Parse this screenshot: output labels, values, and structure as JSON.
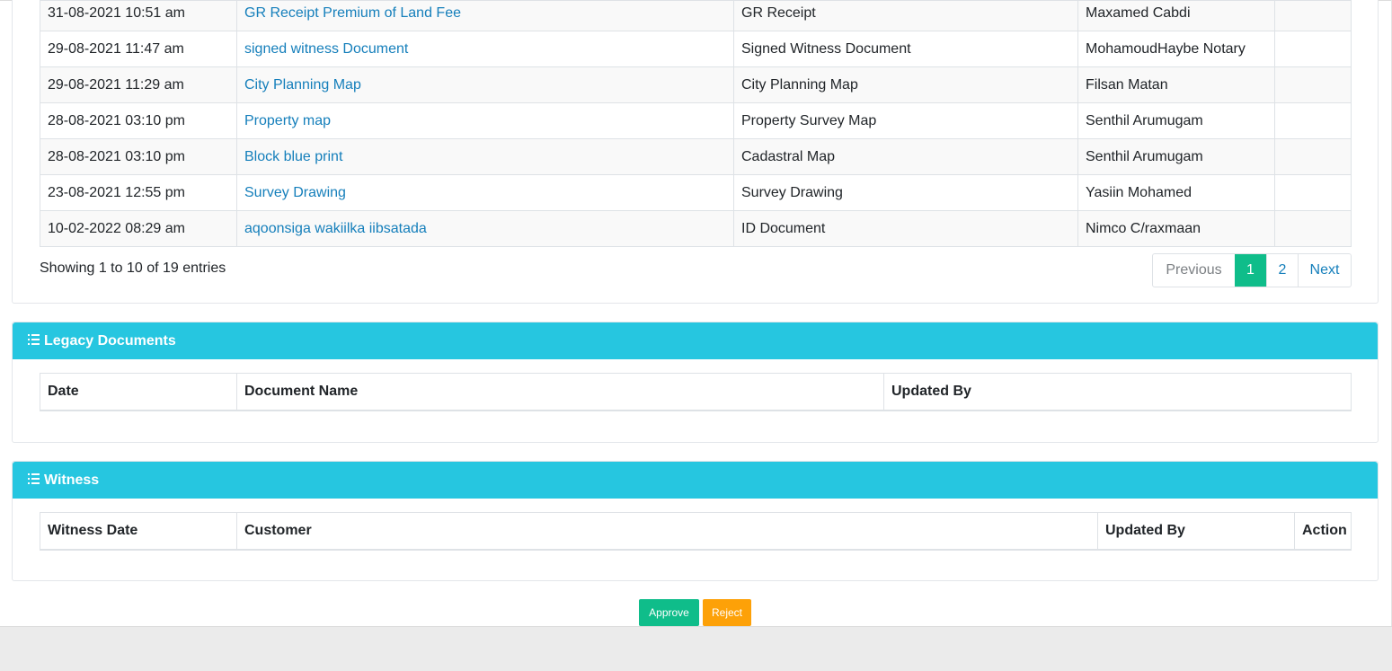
{
  "documents": {
    "rows": [
      {
        "date": "31-08-2021 10:51 am",
        "name": "GR Receipt Premium of Land Fee",
        "type": "GR Receipt",
        "updated_by": "Maxamed Cabdi"
      },
      {
        "date": "29-08-2021 11:47 am",
        "name": "signed witness Document",
        "type": "Signed Witness Document",
        "updated_by": "MohamoudHaybe Notary"
      },
      {
        "date": "29-08-2021 11:29 am",
        "name": "City Planning Map",
        "type": "City Planning Map",
        "updated_by": "Filsan Matan"
      },
      {
        "date": "28-08-2021 03:10 pm",
        "name": "Property map",
        "type": "Property Survey Map",
        "updated_by": "Senthil Arumugam"
      },
      {
        "date": "28-08-2021 03:10 pm",
        "name": "Block blue print",
        "type": "Cadastral Map",
        "updated_by": "Senthil Arumugam"
      },
      {
        "date": "23-08-2021 12:55 pm",
        "name": "Survey Drawing",
        "type": "Survey Drawing",
        "updated_by": "Yasiin Mohamed"
      },
      {
        "date": "10-02-2022 08:29 am",
        "name": "aqoonsiga wakiilka iibsatada",
        "type": "ID Document",
        "updated_by": "Nimco C/raxmaan"
      }
    ],
    "showing": "Showing 1 to 10 of 19 entries",
    "pagination": {
      "previous": "Previous",
      "page1": "1",
      "page2": "2",
      "next": "Next"
    }
  },
  "legacy": {
    "title": "Legacy Documents",
    "columns": {
      "date": "Date",
      "name": "Document Name",
      "updated_by": "Updated By"
    }
  },
  "witness": {
    "title": "Witness",
    "columns": {
      "date": "Witness Date",
      "customer": "Customer",
      "updated_by": "Updated By",
      "action": "Action"
    }
  },
  "actions": {
    "approve": "Approve",
    "reject": "Reject"
  },
  "icons": {
    "section_header": "list-icon"
  },
  "colors": {
    "header": "#26c6e0",
    "link": "#157fbb",
    "approve": "#0fbd8a",
    "reject": "#fda108",
    "active_page": "#0fbd8a"
  }
}
